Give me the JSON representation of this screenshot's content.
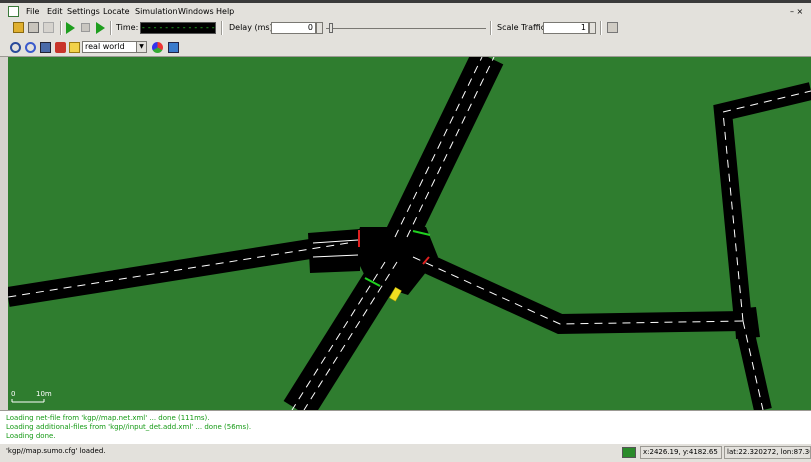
{
  "menu": {
    "items": [
      "File",
      "Edit",
      "Settings",
      "Locate",
      "Simulation",
      "Windows",
      "Help"
    ],
    "window_controls": "– ×"
  },
  "toolbar": {
    "time_label": "Time:",
    "time_value": "--------------------",
    "delay_label": "Delay (ms):",
    "delay_value": "0",
    "scale_traffic_label": "Scale Traffic:",
    "scale_traffic_value": "1"
  },
  "viewbar": {
    "scheme_value": "real world"
  },
  "canvas": {
    "scale_zero": "0",
    "scale_ten": "10m",
    "background": "#2f7d2f"
  },
  "messages": [
    "Loading net-file from 'kgp//map.net.xml' ... done (111ms).",
    "Loading additional-files from 'kgp//input_det.add.xml' ... done (56ms).",
    "Loading done."
  ],
  "status": {
    "loaded_text": "'kgp//map.sumo.cfg' loaded.",
    "coords": "x:2426.19, y:4182.65",
    "latlon": "lat:22.320272, lon:87.3082"
  }
}
